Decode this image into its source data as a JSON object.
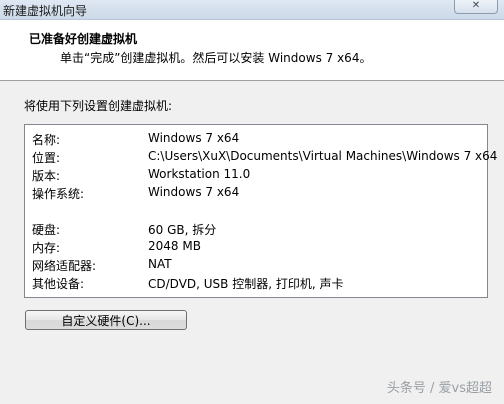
{
  "window": {
    "title": "新建虚拟机向导",
    "close_icon": "close-icon"
  },
  "header": {
    "title": "已准备好创建虚拟机",
    "subtitle": "单击“完成”创建虚拟机。然后可以安装 Windows 7 x64。"
  },
  "intro": "将使用下列设置创建虚拟机:",
  "settings": [
    {
      "label": "名称:",
      "value": "Windows 7 x64"
    },
    {
      "label": "位置:",
      "value": "C:\\Users\\XuX\\Documents\\Virtual Machines\\Windows 7 x64"
    },
    {
      "label": "版本:",
      "value": "Workstation 11.0"
    },
    {
      "label": "操作系统:",
      "value": "Windows 7 x64"
    },
    {
      "label": "硬盘:",
      "value": "60 GB, 拆分"
    },
    {
      "label": "内存:",
      "value": "2048 MB"
    },
    {
      "label": "网络适配器:",
      "value": "NAT"
    },
    {
      "label": "其他设备:",
      "value": "CD/DVD, USB 控制器, 打印机, 声卡"
    }
  ],
  "buttons": {
    "customize": "自定义硬件(C)..."
  },
  "watermark": "头条号 / 爱vs超超"
}
